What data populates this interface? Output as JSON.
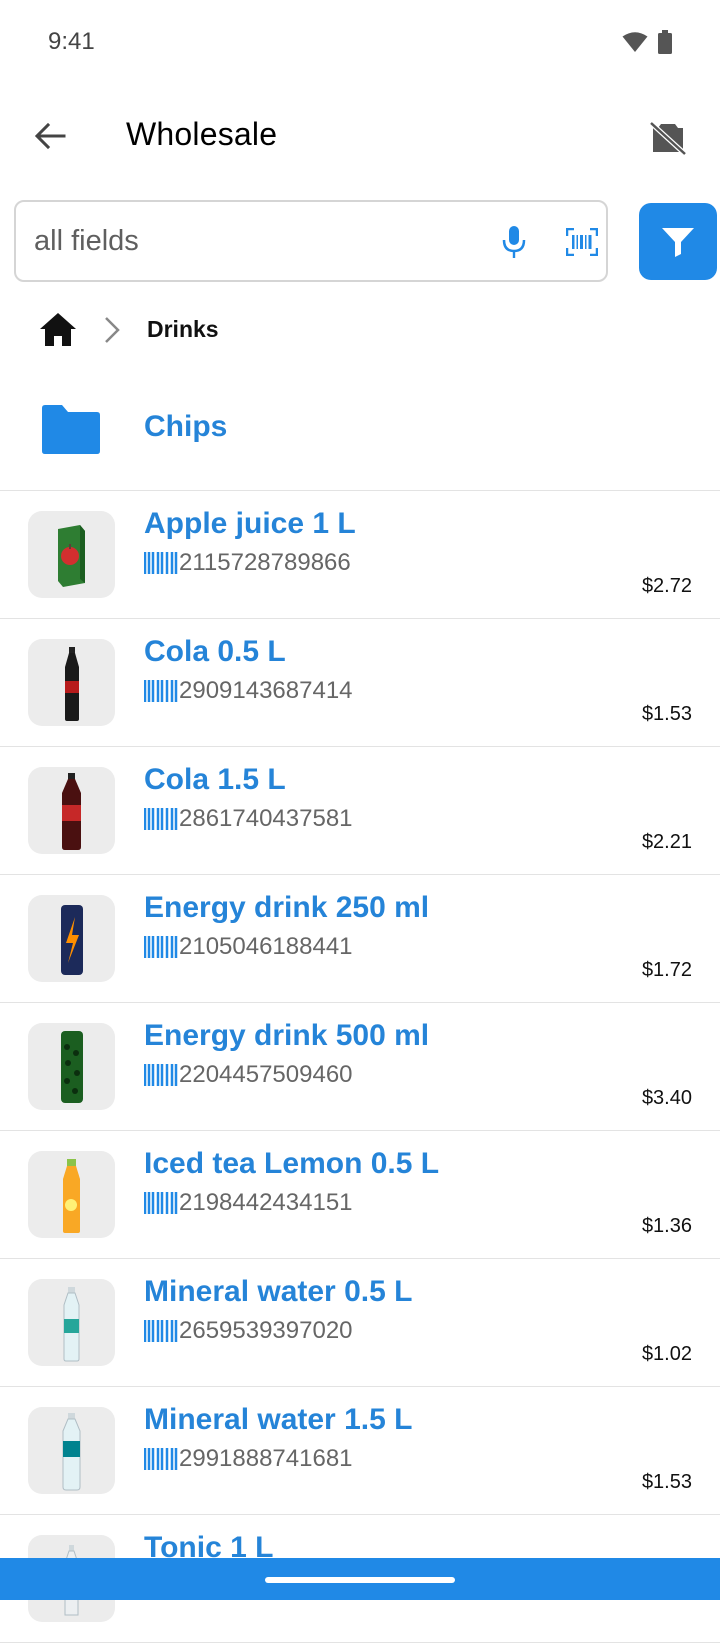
{
  "status_bar": {
    "time": "9:41"
  },
  "app_bar": {
    "title": "Wholesale"
  },
  "search": {
    "placeholder": "all fields",
    "value": ""
  },
  "breadcrumb": {
    "current": "Drinks"
  },
  "folder": {
    "label": "Chips"
  },
  "products": [
    {
      "name": "Apple juice 1 L",
      "barcode": "2115728789866",
      "price": "$2.72",
      "thumb": "apple-juice-carton"
    },
    {
      "name": "Cola 0.5 L",
      "barcode": "2909143687414",
      "price": "$1.53",
      "thumb": "cola-small-bottle"
    },
    {
      "name": "Cola 1.5 L",
      "barcode": "2861740437581",
      "price": "$2.21",
      "thumb": "cola-large-bottle"
    },
    {
      "name": "Energy drink 250 ml",
      "barcode": "2105046188441",
      "price": "$1.72",
      "thumb": "energy-can-blue"
    },
    {
      "name": "Energy drink 500 ml",
      "barcode": "2204457509460",
      "price": "$3.40",
      "thumb": "energy-can-green"
    },
    {
      "name": "Iced tea Lemon 0.5 L",
      "barcode": "2198442434151",
      "price": "$1.36",
      "thumb": "iced-tea-bottle"
    },
    {
      "name": "Mineral water 0.5 L",
      "barcode": "2659539397020",
      "price": "$1.02",
      "thumb": "water-small-bottle"
    },
    {
      "name": "Mineral water 1.5 L",
      "barcode": "2991888741681",
      "price": "$1.53",
      "thumb": "water-large-bottle"
    },
    {
      "name": "Tonic 1 L",
      "barcode": "",
      "price": "",
      "thumb": "tonic-bottle"
    }
  ],
  "colors": {
    "accent": "#2089e6",
    "link": "#2584d8"
  }
}
